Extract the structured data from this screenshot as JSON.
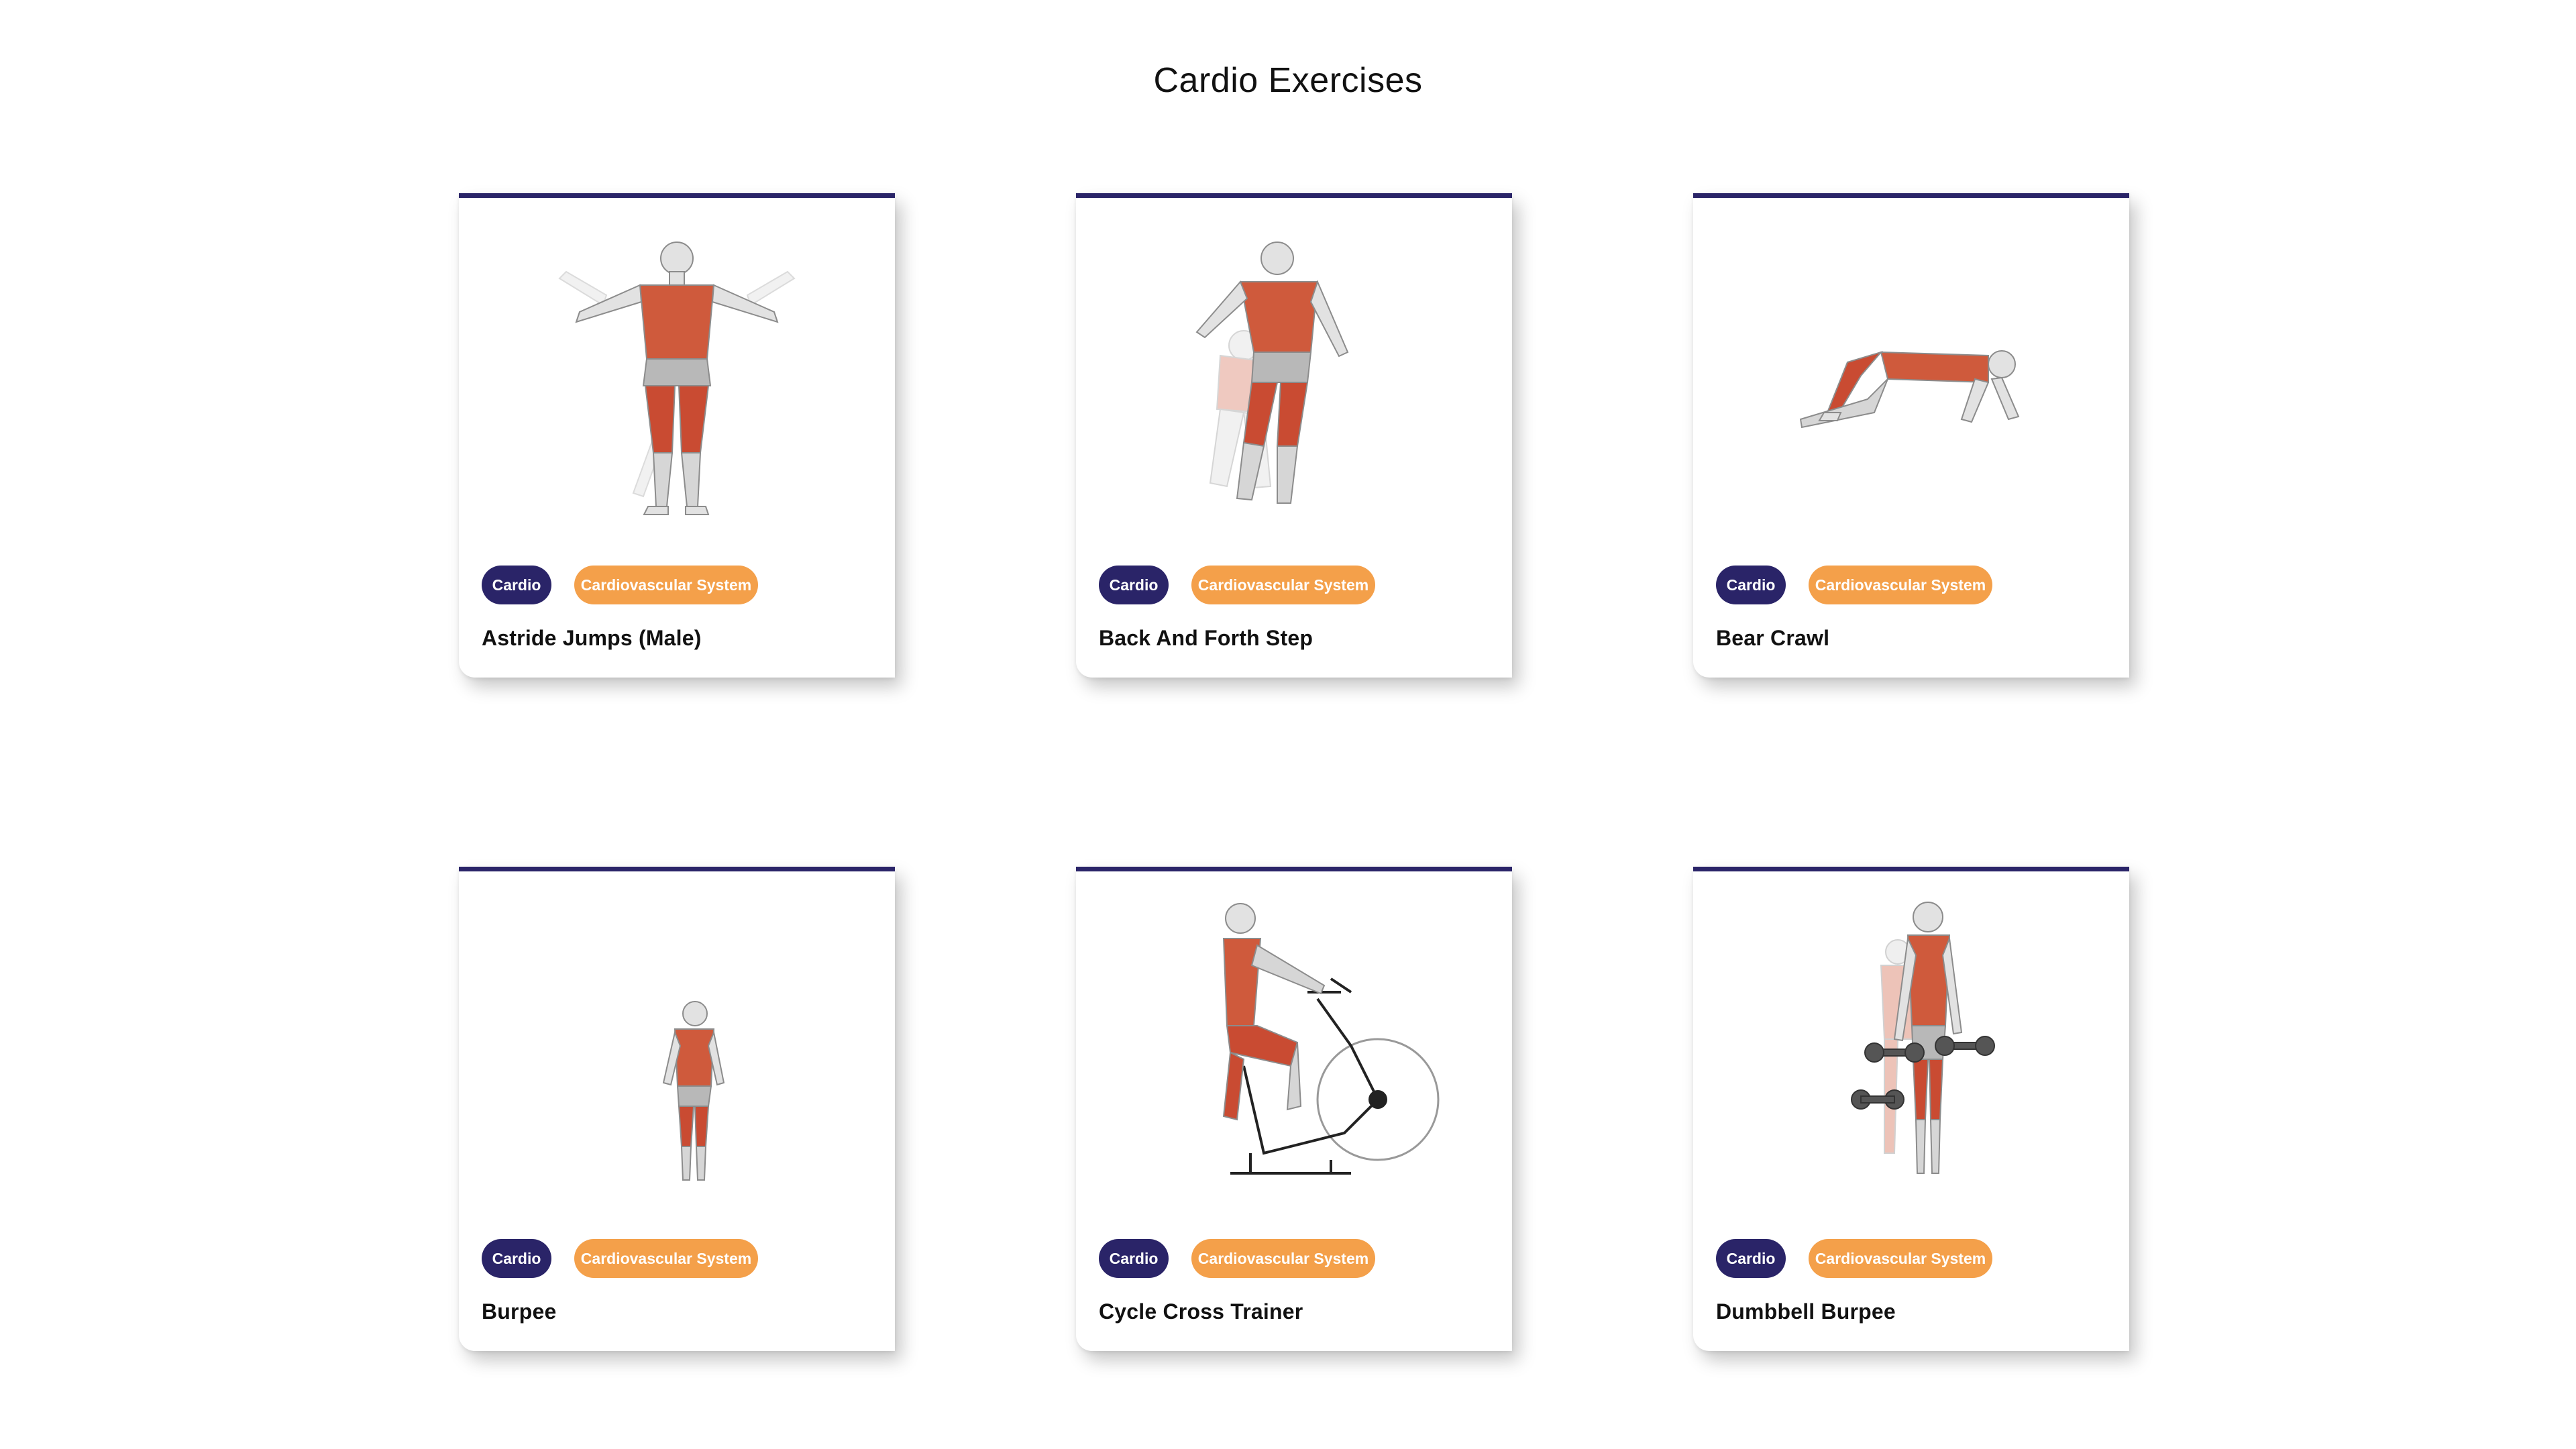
{
  "page": {
    "title": "Cardio Exercises"
  },
  "colors": {
    "accent": "#2a2468",
    "tag_secondary": "#f4a04a",
    "muscle": "#c94b32",
    "body": "#d9d9d9"
  },
  "cards": [
    {
      "name": "Astride Jumps (Male)",
      "tags": [
        "Cardio",
        "Cardiovascular System"
      ],
      "illustration": "astride-jumps-figure"
    },
    {
      "name": "Back And Forth Step",
      "tags": [
        "Cardio",
        "Cardiovascular System"
      ],
      "illustration": "back-and-forth-step-figure"
    },
    {
      "name": "Bear Crawl",
      "tags": [
        "Cardio",
        "Cardiovascular System"
      ],
      "illustration": "bear-crawl-figure"
    },
    {
      "name": "Burpee",
      "tags": [
        "Cardio",
        "Cardiovascular System"
      ],
      "illustration": "burpee-figure"
    },
    {
      "name": "Cycle Cross Trainer",
      "tags": [
        "Cardio",
        "Cardiovascular System"
      ],
      "illustration": "cycle-cross-trainer-figure"
    },
    {
      "name": "Dumbbell Burpee",
      "tags": [
        "Cardio",
        "Cardiovascular System"
      ],
      "illustration": "dumbbell-burpee-figure"
    }
  ]
}
